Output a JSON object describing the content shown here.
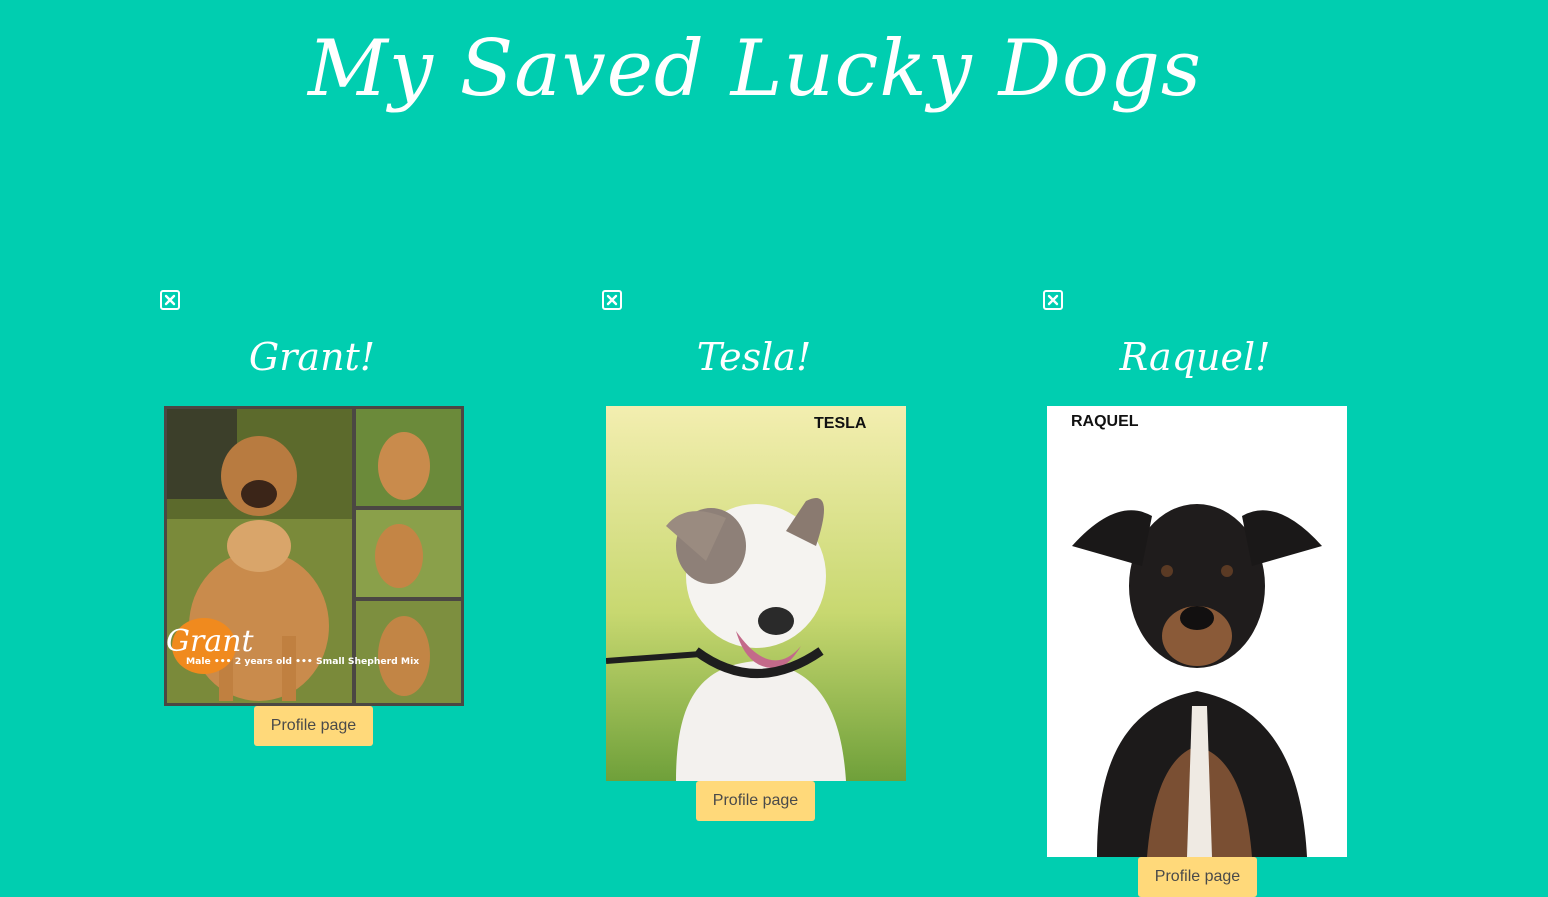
{
  "header": {
    "title": "My Saved Lucky Dogs"
  },
  "dogs": [
    {
      "name": "Grant!",
      "profile_label": "Profile page",
      "photo_icon": "dog-photo-grant",
      "photo_text": {
        "logo": "Grant",
        "caption": "Male ••• 2 years old ••• Small Shepherd Mix"
      }
    },
    {
      "name": "Tesla!",
      "profile_label": "Profile page",
      "photo_icon": "dog-photo-tesla",
      "photo_text": {
        "tag": "TESLA"
      }
    },
    {
      "name": "Raquel!",
      "profile_label": "Profile page",
      "photo_icon": "dog-photo-raquel",
      "photo_text": {
        "tag": "RAQUEL"
      }
    }
  ],
  "remove_icon": "close-square-icon",
  "colors": {
    "background": "#00ceb0",
    "title": "#ffffff",
    "button": "#ffd97a",
    "button_text": "#4a4a4a"
  }
}
